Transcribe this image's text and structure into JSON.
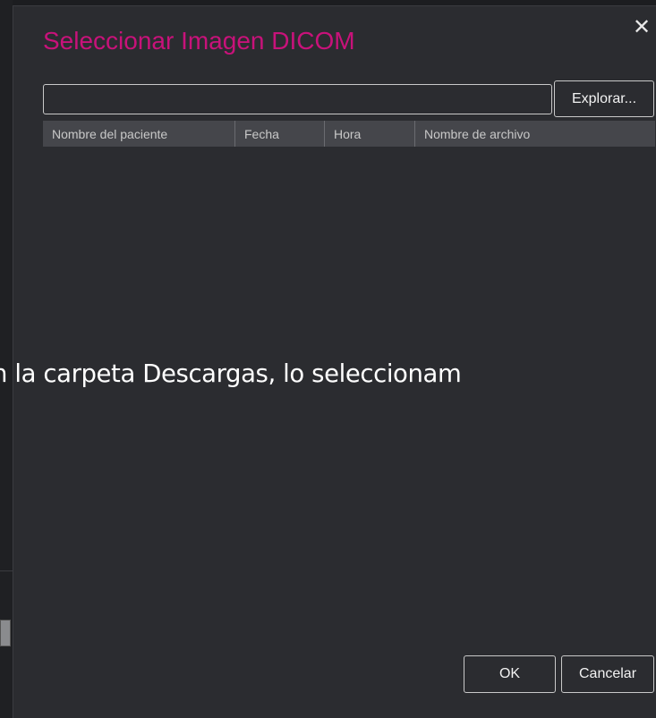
{
  "dialog": {
    "title": "Seleccionar Imagen DICOM",
    "close_icon": "close-icon",
    "path_value": "",
    "browse_label": "Explorar...",
    "ok_label": "OK",
    "cancel_label": "Cancelar",
    "title_color": "#c8127a"
  },
  "table": {
    "columns": [
      "Nombre del paciente",
      "Fecha",
      "Hora",
      "Nombre de archivo"
    ],
    "rows": []
  },
  "overlay": {
    "caption": "n la carpeta Descargas, lo seleccionam"
  }
}
